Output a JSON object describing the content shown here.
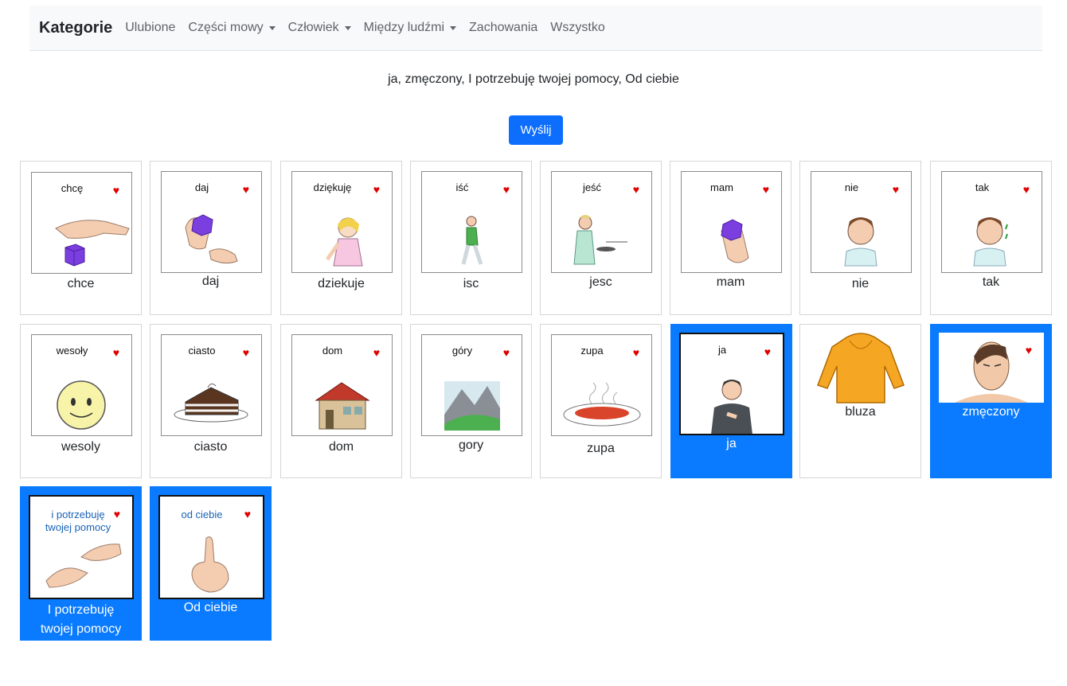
{
  "navbar": {
    "brand": "Kategorie",
    "items": [
      {
        "label": "Ulubione",
        "dropdown": false
      },
      {
        "label": "Części mowy",
        "dropdown": true
      },
      {
        "label": "Człowiek",
        "dropdown": true
      },
      {
        "label": "Między ludźmi",
        "dropdown": true
      },
      {
        "label": "Zachowania",
        "dropdown": false
      },
      {
        "label": "Wszystko",
        "dropdown": false
      }
    ]
  },
  "sentence": "ja, zmęczony, I potrzebuję twojej pomocy, Od ciebie",
  "send_label": "Wyślij",
  "heart_glyph": "♥",
  "cards": [
    {
      "word": "chcę",
      "label": "chce",
      "icon": "hand-cube-icon",
      "selected": false
    },
    {
      "word": "daj",
      "label": "daj",
      "icon": "give-hands-icon",
      "selected": false
    },
    {
      "word": "dziękuję",
      "label": "dziekuje",
      "icon": "girl-thanks-icon",
      "selected": false
    },
    {
      "word": "iść",
      "label": "isc",
      "icon": "walking-man-icon",
      "selected": false
    },
    {
      "word": "jeść",
      "label": "jesc",
      "icon": "eating-person-icon",
      "selected": false
    },
    {
      "word": "mam",
      "label": "mam",
      "icon": "hand-holding-cube-icon",
      "selected": false
    },
    {
      "word": "nie",
      "label": "nie",
      "icon": "boy-shaking-head-icon",
      "selected": false
    },
    {
      "word": "tak",
      "label": "tak",
      "icon": "boy-nodding-icon",
      "selected": false
    },
    {
      "word": "wesoły",
      "label": "wesoly",
      "icon": "smiley-face-icon",
      "selected": false
    },
    {
      "word": "ciasto",
      "label": "ciasto",
      "icon": "cake-slice-icon",
      "selected": false
    },
    {
      "word": "dom",
      "label": "dom",
      "icon": "house-icon",
      "selected": false
    },
    {
      "word": "góry",
      "label": "gory",
      "icon": "mountains-icon",
      "selected": false
    },
    {
      "word": "zupa",
      "label": "zupa",
      "icon": "soup-bowl-icon",
      "selected": false
    },
    {
      "word": "ja",
      "label": "ja",
      "icon": "man-pointing-self-icon",
      "selected": true
    },
    {
      "word": "",
      "label": "bluza",
      "icon": "hoodie-icon",
      "selected": false
    },
    {
      "word": "",
      "label": "zmęczony",
      "icon": "tired-man-icon",
      "selected": true
    },
    {
      "word": "i potrzebuję twojej pomocy",
      "label": "I potrzebuję twojej pomocy",
      "icon": "helping-hands-icon",
      "selected": true
    },
    {
      "word": "od ciebie",
      "label": "Od ciebie",
      "icon": "pointing-finger-icon",
      "selected": true
    }
  ]
}
